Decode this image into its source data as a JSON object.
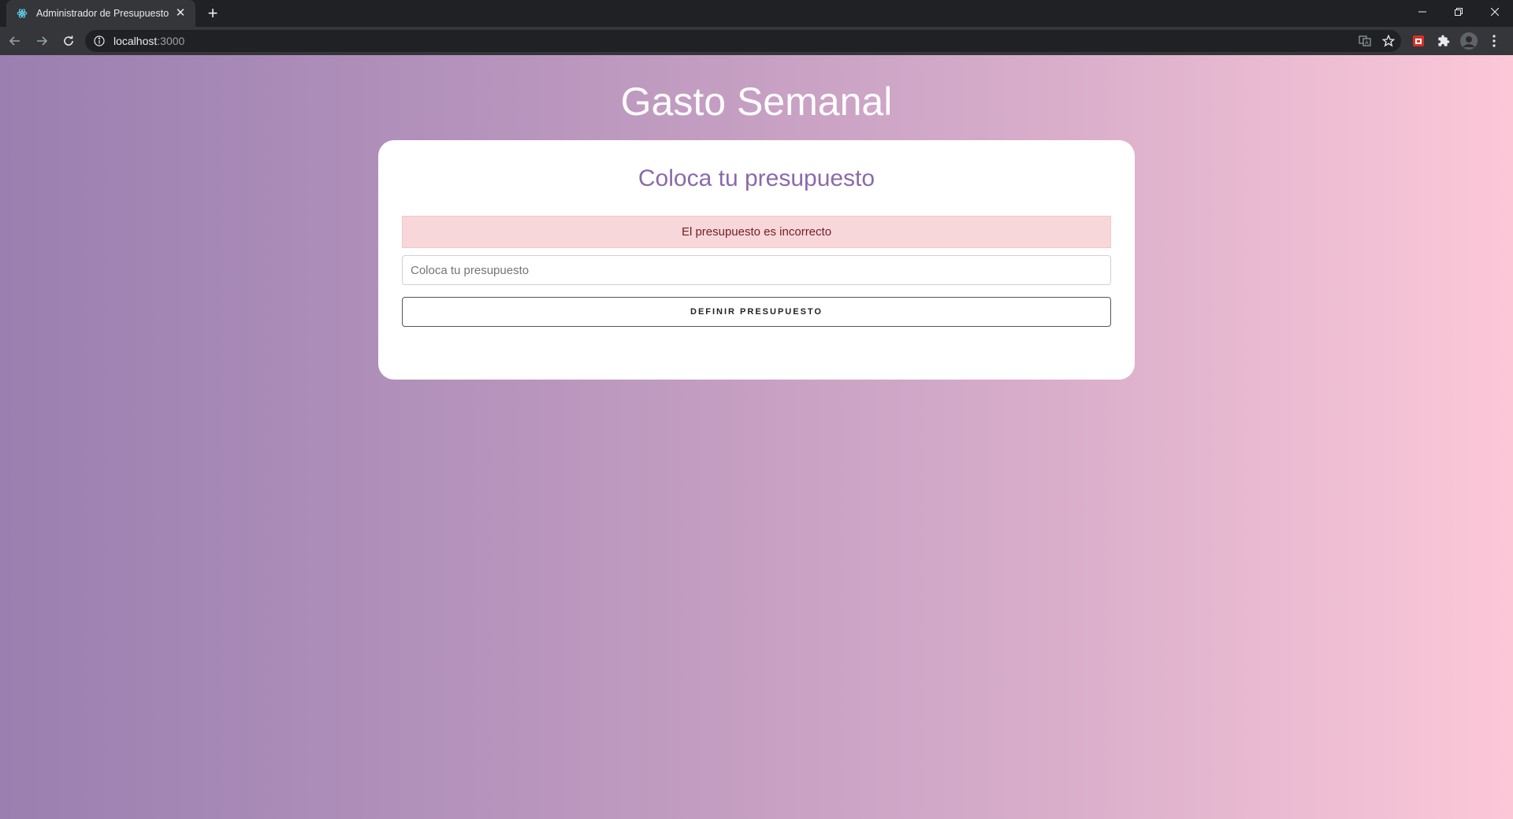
{
  "browser": {
    "tab": {
      "title": "Administrador de Presupuesto",
      "favicon": "react-icon"
    },
    "new_tab_icon": "plus-icon",
    "url": {
      "host": "localhost",
      "port": ":3000"
    },
    "window_controls": [
      "minimize-icon",
      "restore-icon",
      "close-icon"
    ],
    "toolbar_icons": [
      "back-arrow-icon",
      "forward-arrow-icon",
      "reload-icon",
      "info-icon",
      "translate-icon",
      "star-icon",
      "extension-icon",
      "puzzle-icon",
      "profile-avatar",
      "more-menu-icon"
    ]
  },
  "page": {
    "title": "Gasto Semanal",
    "card": {
      "heading": "Coloca tu presupuesto",
      "error": "El presupuesto es incorrecto",
      "input": {
        "value": "",
        "placeholder": "Coloca tu presupuesto"
      },
      "submit_label": "Definir Presupuesto"
    }
  },
  "colors": {
    "gradient_start": "#9a7fb0",
    "gradient_end": "#fcc8d8",
    "heading": "#8a6aab",
    "error_bg": "#f8d7da",
    "error_text": "#721c24"
  }
}
